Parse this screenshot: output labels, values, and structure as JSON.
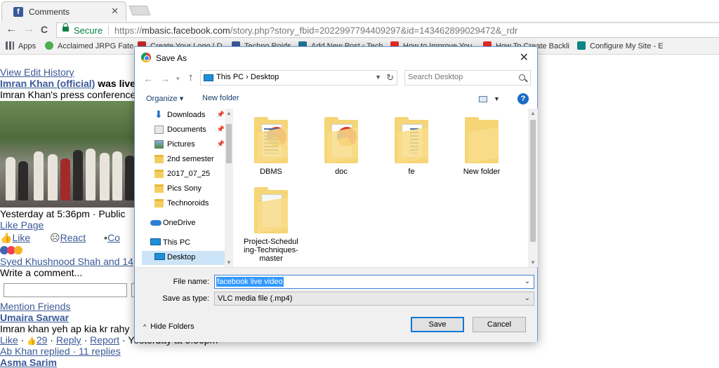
{
  "browser": {
    "tab_title": "Comments",
    "tab_favicon": "f",
    "close_tab": "✕",
    "back": "←",
    "forward": "→",
    "reload": "C",
    "secure_label": "Secure",
    "url_scheme": "https://",
    "url_host": "mbasic.facebook.com",
    "url_path": "/story.php?story_fbid=2022997794409297&id=143462899029472&_rdr",
    "bookmarks": [
      {
        "label": "Apps",
        "color": "#5f6368"
      },
      {
        "label": "Acclaimed JRPG Fate",
        "color": "#4caf50"
      },
      {
        "label": "Create Your Logo | D",
        "color": "#c62828"
      },
      {
        "label": "Techno Roids",
        "color": "#3b5998"
      },
      {
        "label": "Add New Post ‹ Tech",
        "color": "#21759b"
      },
      {
        "label": "How to Improve You",
        "color": "#e52d27"
      },
      {
        "label": "How To Create Backli",
        "color": "#e52d27"
      },
      {
        "label": "Configure My Site - E",
        "color": "#0c8484"
      }
    ]
  },
  "page": {
    "view_edit_history": "View Edit History",
    "poster": "Imran Khan (official)",
    "was_live": "was live",
    "caption": "Imran Khan's press conference",
    "timestamp": "Yesterday at 5:36pm · Public",
    "like_page": "Like Page",
    "like": "Like",
    "react": "React",
    "comment_short": "Co",
    "shared_by": "Syed Khushnood Shah and 14",
    "write_comment": "Write a comment...",
    "mention_friends": "Mention Friends",
    "commenter1": "Umaira Sarwar",
    "comment1": "Imran khan yeh ap kia kr rahy",
    "like_link": "Like",
    "like_count": "29",
    "reply": "Reply",
    "report": "Report",
    "comment_time": "Yesterday at 5:36pm",
    "replied": "Ab Khan replied · 11 replies",
    "commenter2": "Asma Sarim"
  },
  "dialog": {
    "title": "Save As",
    "close": "✕",
    "back": "←",
    "forward": "→",
    "recent": "▾",
    "up": "↑",
    "crumbs": "This PC  ›  Desktop",
    "refresh": "↻",
    "search_placeholder": "Search Desktop",
    "organize": "Organize ▾",
    "new_folder": "New folder",
    "help": "?",
    "nav_items": [
      {
        "label": "Downloads",
        "icon": "downloads-icon",
        "pinned": true
      },
      {
        "label": "Documents",
        "icon": "documents-icon",
        "pinned": true
      },
      {
        "label": "Pictures",
        "icon": "pictures-icon",
        "pinned": true
      },
      {
        "label": "2nd semester",
        "icon": "folder-icon",
        "pinned": false
      },
      {
        "label": "2017_07_25",
        "icon": "folder-icon",
        "pinned": false
      },
      {
        "label": "Pics Sony",
        "icon": "folder-icon",
        "pinned": false
      },
      {
        "label": "Technoroids",
        "icon": "folder-icon",
        "pinned": false
      },
      {
        "label": "OneDrive",
        "icon": "onedrive-icon",
        "pinned": false
      },
      {
        "label": "This PC",
        "icon": "this-pc-icon",
        "pinned": false
      },
      {
        "label": "Desktop",
        "icon": "desktop-icon",
        "pinned": false,
        "selected": true
      }
    ],
    "pin_glyph": "📌",
    "files": [
      {
        "name": "DBMS",
        "kind": "media"
      },
      {
        "name": "doc",
        "kind": "media"
      },
      {
        "name": "fe",
        "kind": "docs"
      },
      {
        "name": "New folder",
        "kind": "empty"
      },
      {
        "name": "Project-Scheduling-Techniques-master",
        "kind": "paper"
      }
    ],
    "file_name_label": "File name:",
    "file_name_value": "facebook live video",
    "save_type_label": "Save as type:",
    "save_type_value": "VLC media file (.mp4)",
    "dropdown_glyph": "⌄",
    "hide_folders": "Hide Folders",
    "hide_glyph": "^",
    "save": "Save",
    "cancel": "Cancel",
    "accent_color": "#0078d7"
  }
}
